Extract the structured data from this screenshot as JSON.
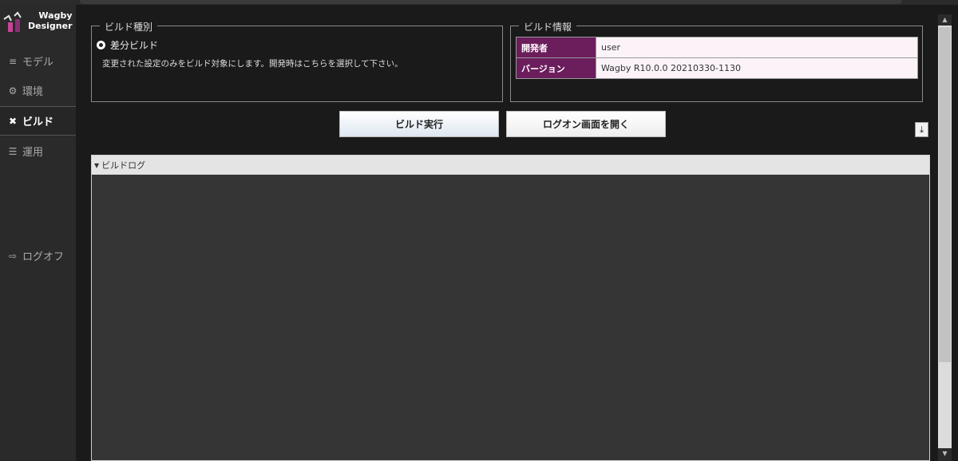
{
  "app": {
    "logo_line1": "Wagby",
    "logo_line2": "Designer"
  },
  "sidebar": {
    "items": [
      {
        "label": "モデル",
        "icon": "database-icon"
      },
      {
        "label": "環境",
        "icon": "gears-icon"
      },
      {
        "label": "ビルド",
        "icon": "wrench-screwdriver-icon",
        "active": true
      },
      {
        "label": "運用",
        "icon": "server-icon"
      },
      {
        "label": "ログオフ",
        "icon": "sign-out-icon"
      }
    ]
  },
  "build_type": {
    "legend": "ビルド種別",
    "option_label": "差分ビルド",
    "description": "変更された設定のみをビルド対象にします。開発時はこちらを選択して下さい。"
  },
  "build_info": {
    "legend": "ビルド情報",
    "rows": [
      {
        "key": "開発者",
        "value": "user"
      },
      {
        "key": "バージョン",
        "value": "Wagby R10.0.0 20210330-1130"
      }
    ]
  },
  "actions": {
    "build_label": "ビルド実行",
    "logon_label": "ログオン画面を開く"
  },
  "log": {
    "title": "ビルドログ"
  },
  "colors": {
    "info_key_bg": "#6b1d5c",
    "info_value_bg": "#fbf3f8",
    "accent_logo": "#c8449a"
  }
}
